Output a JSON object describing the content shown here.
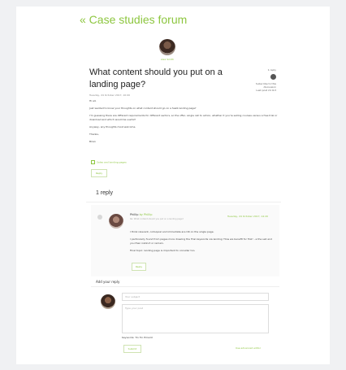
{
  "nav": {
    "back_label": "« Case studies forum"
  },
  "post": {
    "author": "Alex Smith",
    "title": "What content should you put on a landing page?",
    "date": "Tuesday, 24 October 2017, 10:00",
    "side": {
      "posts_label": "1 reply",
      "subscribe_label": "Subscribe to this discussion",
      "meta": "Last post 24 Oct"
    },
    "paragraphs": [
      "Hi all,",
      "Just wanted to know your thoughts on what content should go on a SaaS landing page?",
      "I'm guessing there are different requirements for different sectors, so the offer, single call to action, whether it you're selling courses versus a free trial or download and which would be useful?",
      "Anyway, any thoughts most welcome.",
      "Thanks,",
      "Brian"
    ],
    "tag": "Sales and landing pages",
    "reply_label": "Reply"
  },
  "replies": {
    "count_label": "1 reply",
    "items": [
      {
        "author": "Phillip",
        "by_label": "by Phillip",
        "sub": "Re: What content should you put on a landing page?",
        "date": "Tuesday, 24 October 2017, 14:20",
        "paragraphs": [
          "I think relevant, colloquial and immediate are OK on the single page.",
          "I particularly found from pages more drawing the Trial keywords via landing 'How we benefit for first' - a the sell and you then instinct or remain.",
          "Final topic: landing page is important to consider too."
        ],
        "reply_label": "Reply"
      }
    ]
  },
  "compose": {
    "heading": "Add your reply",
    "subject_placeholder": "Your subject",
    "text_placeholder": "Type your post",
    "keywords": "Keywords: Tin Tin Emaint",
    "submit_label": "Submit",
    "advanced_label": "Use advanced editor"
  }
}
